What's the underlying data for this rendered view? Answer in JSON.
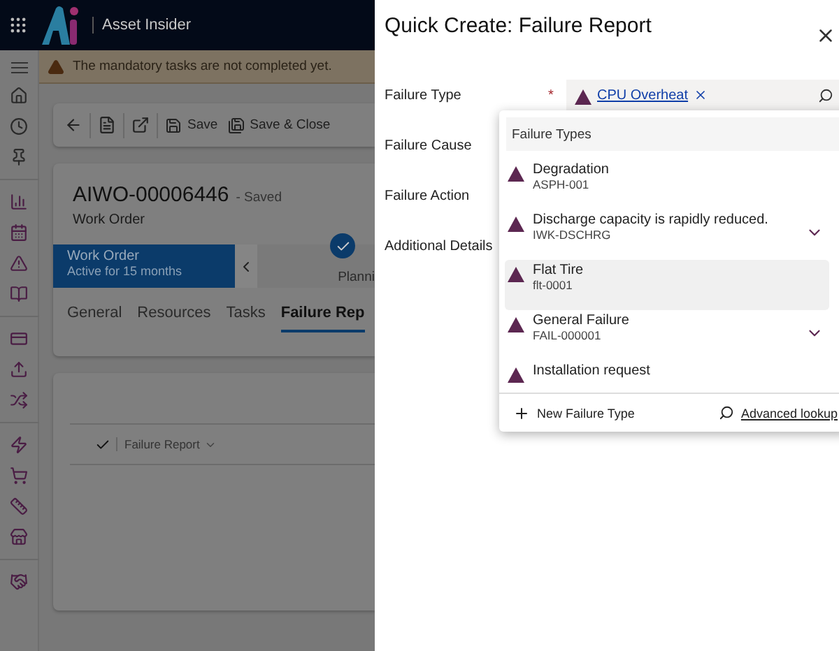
{
  "app": {
    "title": "Asset Insider"
  },
  "warning": "The mandatory tasks are not completed yet.",
  "toolbar": [
    {
      "kind": "back"
    },
    {
      "kind": "form"
    },
    {
      "kind": "popout"
    },
    {
      "kind": "save",
      "label": "Save"
    },
    {
      "kind": "saveclose",
      "label": "Save & Close"
    }
  ],
  "record": {
    "title": "AIWO-00006446",
    "status": "- Saved",
    "entity": "Work Order"
  },
  "stage": {
    "name": "Work Order",
    "duration": "Active for 15 months",
    "next": "Planni"
  },
  "tabs": [
    {
      "label": "General",
      "selected": false
    },
    {
      "label": "Resources",
      "selected": false
    },
    {
      "label": "Tasks",
      "selected": false
    },
    {
      "label": "Failure Rep",
      "selected": true
    }
  ],
  "subgrid": {
    "view": "Failure Report"
  },
  "dialog": {
    "title": "Quick Create: Failure Report",
    "fields": [
      {
        "label": "Failure Type",
        "required_mark": "*",
        "value": "CPU Overheat"
      },
      {
        "label": "Failure Cause"
      },
      {
        "label": "Failure Action"
      },
      {
        "label": "Additional Details"
      }
    ],
    "dropdown": {
      "header": "Failure Types",
      "items": [
        {
          "name": "Degradation",
          "code": "ASPH-001",
          "expandable": false,
          "selected": false
        },
        {
          "name": "Discharge capacity is rapidly reduced.",
          "code": "IWK-DSCHRG",
          "expandable": true,
          "selected": false
        },
        {
          "name": "Flat Tire",
          "code": "flt-0001",
          "expandable": false,
          "selected": true
        },
        {
          "name": "General Failure",
          "code": "FAIL-000001",
          "expandable": true,
          "selected": false
        },
        {
          "name": "Installation request",
          "expandable": false,
          "selected": false
        }
      ],
      "new_label": "New Failure Type",
      "lookup_label": "Advanced lookup"
    }
  }
}
